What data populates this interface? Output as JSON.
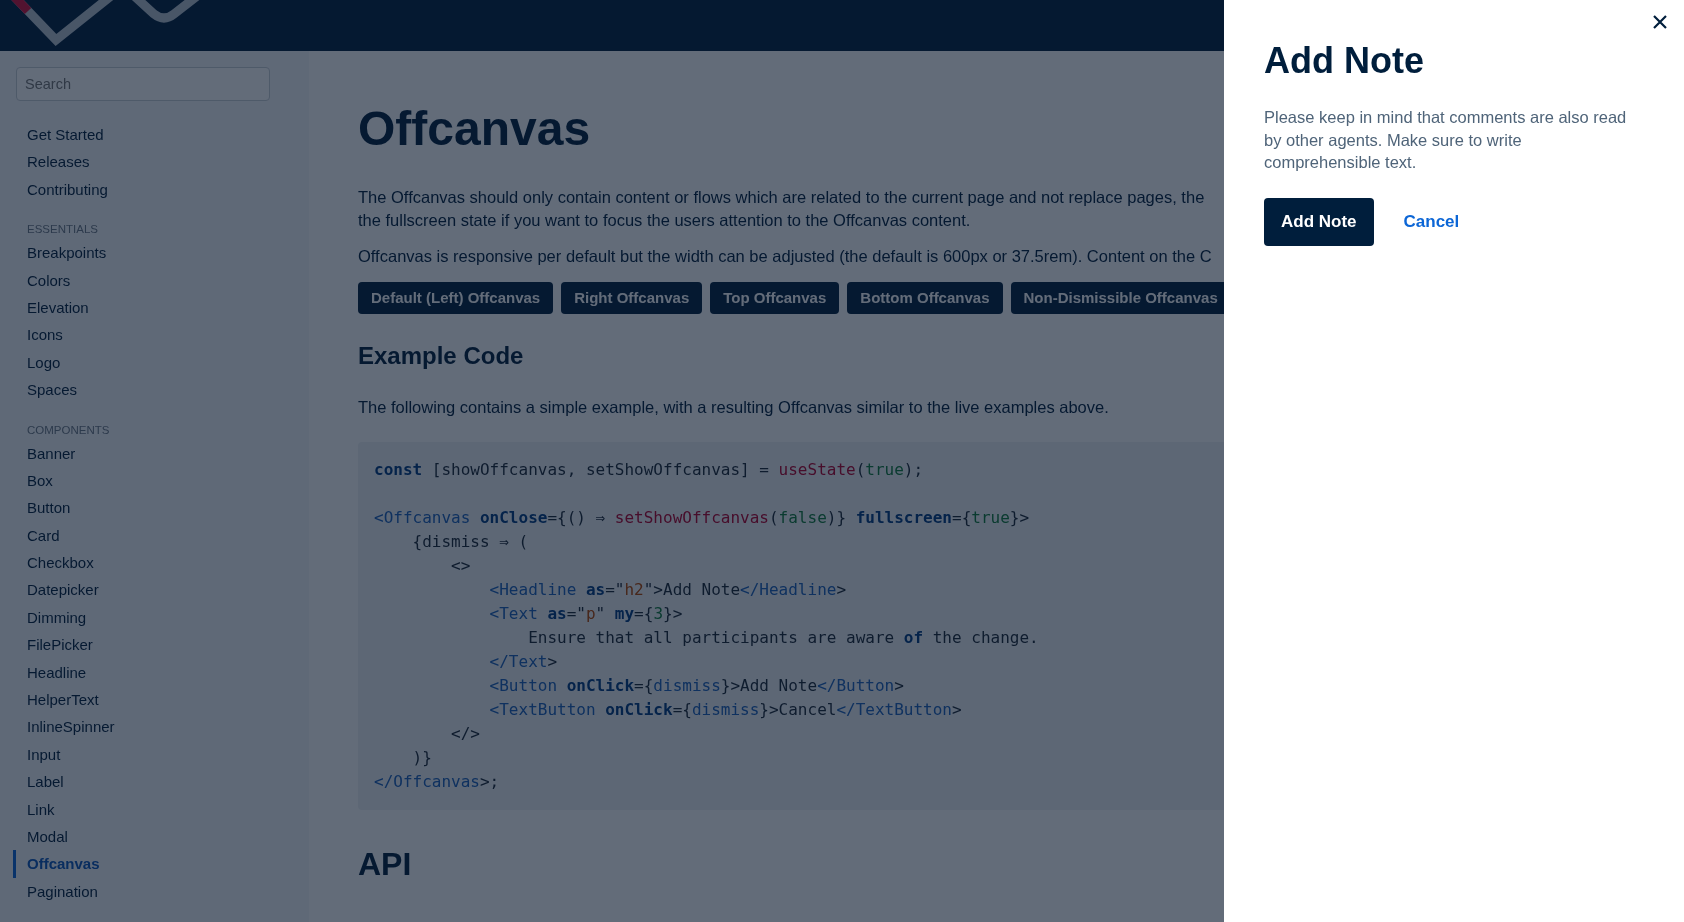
{
  "sidebar": {
    "search": {
      "placeholder": "Search"
    },
    "groups": [
      {
        "items": [
          {
            "label": "Get Started",
            "selected": false
          },
          {
            "label": "Releases",
            "selected": false
          },
          {
            "label": "Contributing",
            "selected": false
          }
        ]
      },
      {
        "heading": "ESSENTIALS",
        "items": [
          {
            "label": "Breakpoints",
            "selected": false
          },
          {
            "label": "Colors",
            "selected": false
          },
          {
            "label": "Elevation",
            "selected": false
          },
          {
            "label": "Icons",
            "selected": false
          },
          {
            "label": "Logo",
            "selected": false
          },
          {
            "label": "Spaces",
            "selected": false
          }
        ]
      },
      {
        "heading": "COMPONENTS",
        "items": [
          {
            "label": "Banner",
            "selected": false
          },
          {
            "label": "Box",
            "selected": false
          },
          {
            "label": "Button",
            "selected": false
          },
          {
            "label": "Card",
            "selected": false
          },
          {
            "label": "Checkbox",
            "selected": false
          },
          {
            "label": "Datepicker",
            "selected": false
          },
          {
            "label": "Dimming",
            "selected": false
          },
          {
            "label": "FilePicker",
            "selected": false
          },
          {
            "label": "Headline",
            "selected": false
          },
          {
            "label": "HelperText",
            "selected": false
          },
          {
            "label": "InlineSpinner",
            "selected": false
          },
          {
            "label": "Input",
            "selected": false
          },
          {
            "label": "Label",
            "selected": false
          },
          {
            "label": "Link",
            "selected": false
          },
          {
            "label": "Modal",
            "selected": false
          },
          {
            "label": "Offcanvas",
            "selected": true
          },
          {
            "label": "Pagination",
            "selected": false
          }
        ]
      }
    ]
  },
  "main": {
    "title": "Offcanvas",
    "paragraphs": [
      "The Offcanvas should only contain content or flows which are related to the current page and not replace pages, the",
      "the fullscreen state if you want to focus the users attention to the Offcanvas content.",
      "Offcanvas is responsive per default but the width can be adjusted (the default is 600px or 37.5rem). Content on the C"
    ],
    "buttons": [
      "Default (Left) Offcanvas",
      "Right Offcanvas",
      "Top Offcanvas",
      "Bottom Offcanvas",
      "Non-Dismissible Offcanvas"
    ],
    "example_heading": "Example Code",
    "example_text": "The following contains a simple example, with a resulting Offcanvas similar to the live examples above.",
    "code": [
      {
        "tokens": [
          {
            "kind": "kw",
            "text": "const"
          },
          {
            "kind": "plain",
            "text": " [showOffcanvas, setShowOffcanvas] = "
          },
          {
            "kind": "fn",
            "text": "useState"
          },
          {
            "kind": "plain",
            "text": "("
          },
          {
            "kind": "val",
            "text": "true"
          },
          {
            "kind": "plain",
            "text": ");"
          }
        ]
      },
      {
        "gap_before": true,
        "tokens": [
          {
            "kind": "tag",
            "text": "<Offcanvas"
          },
          {
            "kind": "kw",
            "text": " onClose"
          },
          {
            "kind": "plain",
            "text": "={() ⇒ "
          },
          {
            "kind": "fn",
            "text": "setShowOffcanvas"
          },
          {
            "kind": "plain",
            "text": "("
          },
          {
            "kind": "val",
            "text": "false"
          },
          {
            "kind": "plain",
            "text": ")} "
          },
          {
            "kind": "kw",
            "text": "fullscreen"
          },
          {
            "kind": "plain",
            "text": "={"
          },
          {
            "kind": "val",
            "text": "true"
          },
          {
            "kind": "plain",
            "text": "}>"
          }
        ]
      },
      {
        "tokens": [
          {
            "kind": "plain",
            "text": "    {dismiss ⇒ ("
          }
        ]
      },
      {
        "tokens": [
          {
            "kind": "plain",
            "text": "        <>"
          }
        ]
      },
      {
        "tokens": [
          {
            "kind": "tag",
            "text": "            <Headline"
          },
          {
            "kind": "kw",
            "text": " as"
          },
          {
            "kind": "plain",
            "text": "=\""
          },
          {
            "kind": "str",
            "text": "h2"
          },
          {
            "kind": "plain",
            "text": "\">Add Note"
          },
          {
            "kind": "tag",
            "text": "</Headline"
          },
          {
            "kind": "plain",
            "text": ">"
          }
        ]
      },
      {
        "tokens": [
          {
            "kind": "tag",
            "text": "            <Text"
          },
          {
            "kind": "kw",
            "text": " as"
          },
          {
            "kind": "plain",
            "text": "=\""
          },
          {
            "kind": "str",
            "text": "p"
          },
          {
            "kind": "plain",
            "text": "\" "
          },
          {
            "kind": "kw",
            "text": "my"
          },
          {
            "kind": "plain",
            "text": "={"
          },
          {
            "kind": "val",
            "text": "3"
          },
          {
            "kind": "plain",
            "text": "}>"
          }
        ]
      },
      {
        "tokens": [
          {
            "kind": "plain",
            "text": "                Ensure that all participants are aware "
          },
          {
            "kind": "kw",
            "text": "of"
          },
          {
            "kind": "plain",
            "text": " the change."
          }
        ]
      },
      {
        "tokens": [
          {
            "kind": "tag",
            "text": "            </Text"
          },
          {
            "kind": "plain",
            "text": ">"
          }
        ]
      },
      {
        "tokens": [
          {
            "kind": "tag",
            "text": "            <Button"
          },
          {
            "kind": "kw",
            "text": " onClick"
          },
          {
            "kind": "plain",
            "text": "={"
          },
          {
            "kind": "tag",
            "text": "dismiss"
          },
          {
            "kind": "plain",
            "text": "}>Add Note"
          },
          {
            "kind": "tag",
            "text": "</Button"
          },
          {
            "kind": "plain",
            "text": ">"
          }
        ]
      },
      {
        "tokens": [
          {
            "kind": "tag",
            "text": "            <TextButton"
          },
          {
            "kind": "kw",
            "text": " onClick"
          },
          {
            "kind": "plain",
            "text": "={"
          },
          {
            "kind": "tag",
            "text": "dismiss"
          },
          {
            "kind": "plain",
            "text": "}>Cancel"
          },
          {
            "kind": "tag",
            "text": "</TextButton"
          },
          {
            "kind": "plain",
            "text": ">"
          }
        ]
      },
      {
        "tokens": [
          {
            "kind": "plain",
            "text": "        </>"
          }
        ]
      },
      {
        "tokens": [
          {
            "kind": "plain",
            "text": "    )}"
          }
        ]
      },
      {
        "tokens": [
          {
            "kind": "tag",
            "text": "</Offcanvas"
          },
          {
            "kind": "plain",
            "text": ">;"
          }
        ]
      }
    ],
    "api_heading": "API"
  },
  "offcanvas": {
    "title": "Add Note",
    "text": "Please keep in mind that comments are also read by other agents. Make sure to write comprehensible text.",
    "primary_button": "Add Note",
    "secondary_button": "Cancel"
  }
}
